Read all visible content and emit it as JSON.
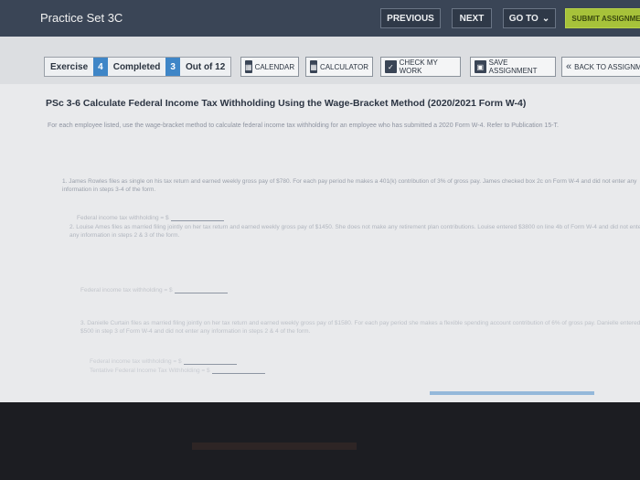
{
  "window": {
    "title": "Practice Set 3C"
  },
  "nav": {
    "previous": "PREVIOUS",
    "next": "NEXT",
    "goto": "GO TO",
    "submit": "SUBMIT ASSIGNME"
  },
  "status": {
    "exercise_label": "Exercise",
    "exercise_count": "4",
    "completed_label": "Completed",
    "completed_count": "3",
    "out_of": "Out of 12"
  },
  "tools": {
    "calendar": "CALENDAR",
    "calculator": "CALCULATOR",
    "check": "CHECK MY WORK",
    "save": "SAVE ASSIGNMENT",
    "back": "BACK TO ASSIGNM"
  },
  "question": {
    "title": "PSc 3-6 Calculate Federal Income Tax Withholding Using the Wage-Bracket Method (2020/2021 Form W-4)",
    "instructions": "For each employee listed, use the wage-bracket method to calculate federal income tax withholding for an employee who has submitted a 2020 Form W-4. Refer to Publication 15-T.",
    "items": [
      {
        "text": "1. James Rowles files as single on his tax return and earned weekly gross pay of $780. For each pay period he makes a 401(k) contribution of 3% of gross pay. James checked box 2c on Form W-4 and did not enter any information in steps 3-4 of the form.",
        "answer_label": "Federal income tax withholding = $"
      },
      {
        "text": "2. Louise Ames files as married filing jointly on her tax return and earned weekly gross pay of $1450. She does not make any retirement plan contributions. Louise entered $3800 on line 4b of Form W-4 and did not enter any information in steps 2 & 3 of the form.",
        "answer_label": "Federal income tax withholding = $"
      },
      {
        "text": "3. Danielle Curtain files as married filing jointly on her tax return and earned weekly gross pay of $1580. For each pay period she makes a flexible spending account contribution of 6% of gross pay. Danielle entered $500 in step 3 of Form W-4 and did not enter any information in steps 2 & 4 of the form.",
        "answer_label": "Federal income tax withholding = $",
        "answer_label_2": "Tentative Federal Income Tax Withholding = $"
      }
    ]
  }
}
